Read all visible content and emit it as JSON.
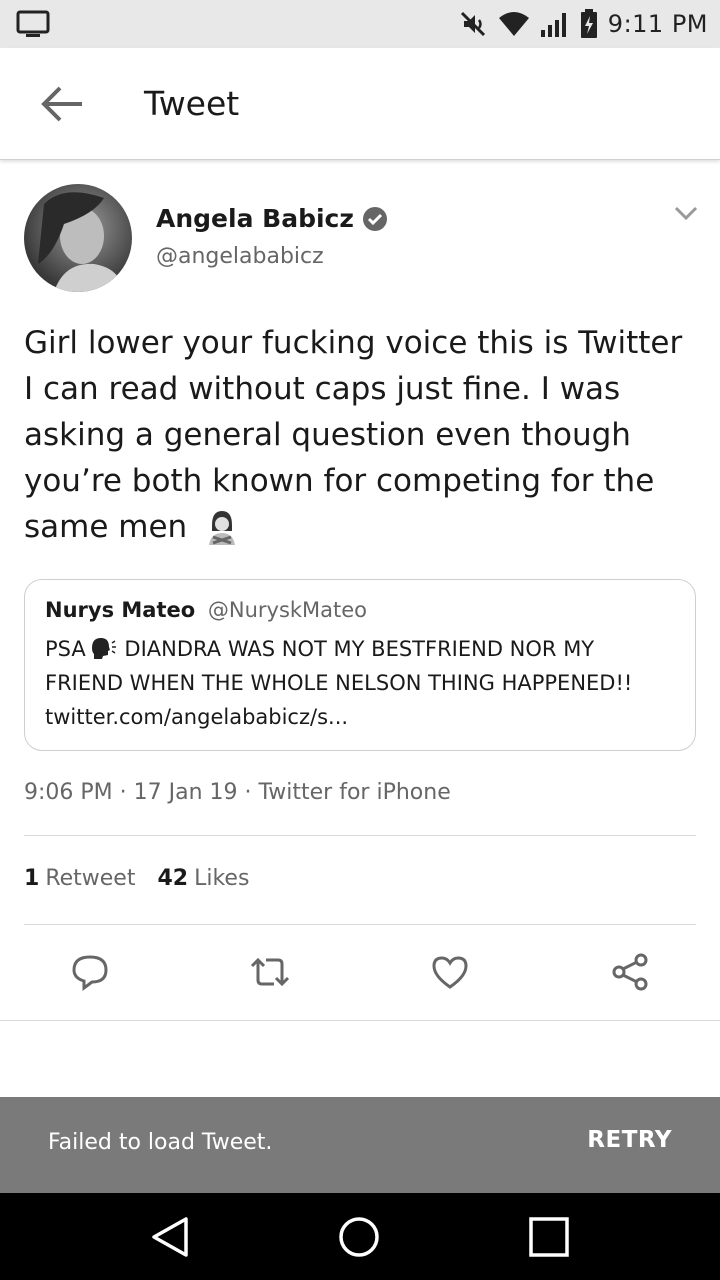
{
  "status_bar": {
    "time": "9:11 PM",
    "icons": [
      "screen-icon",
      "mute-icon",
      "wifi-icon",
      "signal-icon",
      "battery-charging-icon"
    ]
  },
  "app_bar": {
    "title": "Tweet",
    "back_icon": "arrow-left-icon"
  },
  "tweet": {
    "author_name": "Angela Babicz",
    "author_handle": "@angelababicz",
    "verified": true,
    "text": "Girl lower your fucking voice this is Twitter I can read without caps just fine. I was asking a general question even though you’re both known for competing for the same men",
    "emoji": "person-gesturing-no",
    "timestamp": "9:06 PM · 17 Jan 19 · Twitter for iPhone",
    "retweets_count": "1",
    "retweets_label": "Retweet",
    "likes_count": "42",
    "likes_label": "Likes"
  },
  "quote": {
    "name": "Nurys Mateo",
    "handle": "@NuryskMateo",
    "text_before": "PSA",
    "text_after": " DIANDRA WAS NOT MY BESTFRIEND NOR MY FRIEND WHEN THE WHOLE NELSON THING HAPPENED!! twitter.com/angelababicz/s..."
  },
  "actions": [
    "reply-icon",
    "retweet-icon",
    "like-icon",
    "share-icon"
  ],
  "snackbar": {
    "message": "Failed to load Tweet.",
    "action": "RETRY"
  },
  "nav": [
    "back-triangle-icon",
    "home-circle-icon",
    "recents-square-icon"
  ],
  "colors": {
    "text": "#1a1a1a",
    "secondary_text": "#666666",
    "snackbar_bg": "#7a7a7a",
    "status_bar_bg": "#e8e8e8",
    "nav_bg": "#000000"
  }
}
